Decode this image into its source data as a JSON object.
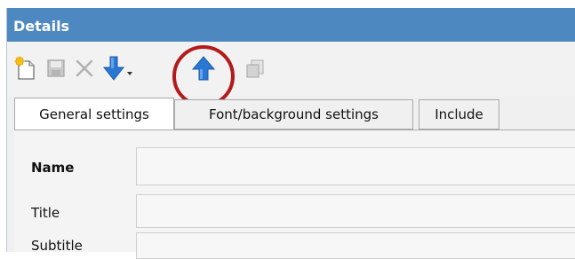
{
  "panel": {
    "title": "Details"
  },
  "toolbar": {
    "buttons": [
      {
        "name": "new-icon"
      },
      {
        "name": "save-icon"
      },
      {
        "name": "delete-icon"
      },
      {
        "name": "move-down-icon"
      },
      {
        "name": "move-up-icon"
      },
      {
        "name": "copy-icon"
      }
    ],
    "highlight_color": "#b31b1b"
  },
  "tabs": [
    {
      "label": "General settings",
      "active": true
    },
    {
      "label": "Font/background settings",
      "active": false
    },
    {
      "label": "Include",
      "active": false
    }
  ],
  "form": {
    "name_label": "Name",
    "name_value": "",
    "title_label": "Title",
    "title_value": "",
    "subtitle_label": "Subtitle",
    "subtitle_value": ""
  },
  "colors": {
    "titlebar": "#4e88c0",
    "arrow_blue": "#2a78d4"
  }
}
